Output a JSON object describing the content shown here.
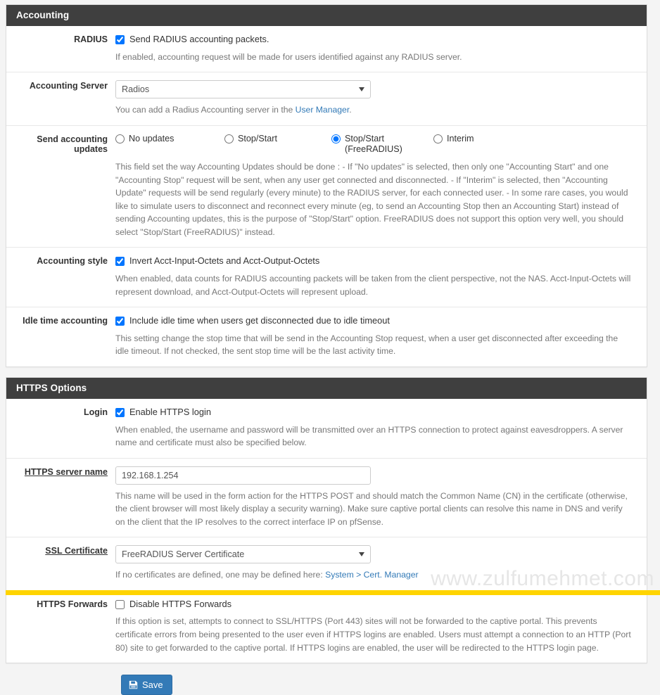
{
  "colors": {
    "panel_heading_bg": "#3f3f3f",
    "page_bg": "#f4f4f4",
    "link": "#337ab7",
    "save_button": "#337ab7",
    "bottom_bar": "#ffd400",
    "watermark": "#e6e6e6"
  },
  "accounting": {
    "heading": "Accounting",
    "radius": {
      "label": "RADIUS",
      "checkbox_label": "Send RADIUS accounting packets.",
      "checked": true,
      "help": "If enabled, accounting request will be made for users identified against any RADIUS server."
    },
    "accounting_server": {
      "label": "Accounting Server",
      "value": "Radios",
      "options": [
        "Radios"
      ],
      "help_prefix": "You can add a Radius Accounting server in the ",
      "help_link": "User Manager",
      "help_suffix": "."
    },
    "send_updates": {
      "label": "Send accounting updates",
      "options": [
        {
          "label": "No updates",
          "selected": false
        },
        {
          "label": "Stop/Start",
          "selected": false
        },
        {
          "label": "Stop/Start (FreeRADIUS)",
          "selected": true
        },
        {
          "label": "Interim",
          "selected": false
        }
      ],
      "help": "This field set the way Accounting Updates should be done :\n- If \"No updates\" is selected, then only one \"Accounting Start\" and one \"Accounting Stop\" request will be sent, when any user get connected and disconnected.\n- If \"Interim\" is selected, then \"Accounting Update\" requests will be send regularly (every minute) to the RADIUS server, for each connected user.\n- In some rare cases, you would like to simulate users to disconnect and reconnect every minute (eg, to send an Accounting Stop then an Accounting Start) instead of sending Accounting updates, this is the purpose of \"Stop/Start\" option. FreeRADIUS does not support this option very well, you should select \"Stop/Start (FreeRADIUS)\" instead."
    },
    "accounting_style": {
      "label": "Accounting style",
      "checkbox_label": "Invert Acct-Input-Octets and Acct-Output-Octets",
      "checked": true,
      "help": "When enabled, data counts for RADIUS accounting packets will be taken from the client perspective, not the NAS. Acct-Input-Octets will represent download, and Acct-Output-Octets will represent upload."
    },
    "idle_time": {
      "label": "Idle time accounting",
      "checkbox_label": "Include idle time when users get disconnected due to idle timeout",
      "checked": true,
      "help": "This setting change the stop time that will be send in the Accounting Stop request, when a user get disconnected after exceeding the idle timeout. If not checked, the sent stop time will be the last activity time."
    }
  },
  "https_options": {
    "heading": "HTTPS Options",
    "login": {
      "label": "Login",
      "checkbox_label": "Enable HTTPS login",
      "checked": true,
      "help": "When enabled, the username and password will be transmitted over an HTTPS connection to protect against eavesdroppers. A server name and certificate must also be specified below."
    },
    "server_name": {
      "label": "HTTPS server name",
      "value": "192.168.1.254",
      "placeholder": "",
      "help": "This name will be used in the form action for the HTTPS POST and should match the Common Name (CN) in the certificate (otherwise, the client browser will most likely display a security warning). Make sure captive portal clients can resolve this name in DNS and verify on the client that the IP resolves to the correct interface IP on pfSense."
    },
    "ssl_certificate": {
      "label": "SSL Certificate",
      "value": "FreeRADIUS Server Certificate",
      "options": [
        "FreeRADIUS Server Certificate"
      ],
      "help_prefix": "If no certificates are defined, one may be defined here: ",
      "help_link": "System > Cert. Manager",
      "help_suffix": ""
    },
    "https_forwards": {
      "label": "HTTPS Forwards",
      "checkbox_label": "Disable HTTPS Forwards",
      "checked": false,
      "help": "If this option is set, attempts to connect to SSL/HTTPS (Port 443) sites will not be forwarded to the captive portal. This prevents certificate errors from being presented to the user even if HTTPS logins are enabled. Users must attempt a connection to an HTTP (Port 80) site to get forwarded to the captive portal. If HTTPS logins are enabled, the user will be redirected to the HTTPS login page."
    }
  },
  "actions": {
    "save_label": "Save",
    "save_icon": "save-floppy-icon"
  },
  "watermark": {
    "text": "www.zulfumehmet.com"
  }
}
